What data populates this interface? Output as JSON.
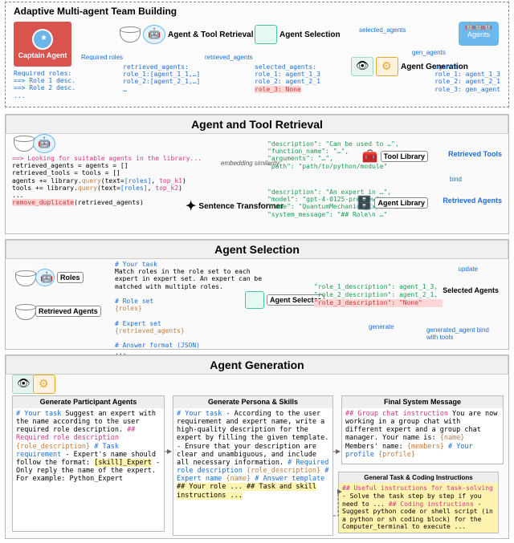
{
  "top": {
    "title": "Adaptive Multi-agent Team Building",
    "captain": "Captain Agent",
    "stages": {
      "retrieval": "Agent & Tool Retrieval",
      "selection": "Agent Selection",
      "generation": "Agent Generation",
      "agents": "Agents"
    },
    "arrows": {
      "required_roles": "Required roles",
      "retrieved_agents": "retrieved_agents",
      "selected_agents": "selected_agents",
      "gen_agents": "gen_agents"
    },
    "required_roles_block": "Required roles:\n==> Role 1 desc.\n==> Role 2 desc.\n...",
    "retrieved_block": "retrieved_agents:\nrole_1:[agent_1_1,…]\nrole_2:[agent_2_1,…]\n…",
    "selected_block": "selected_agents:\nrole_1: agent_1_3\nrole_2: agent_2_1",
    "selected_none": "role_3: None",
    "agents_block": "agents:\nrole_1: agent_1_3\nrole_2: agent_2_1\nrole_3: gen_agent"
  },
  "retrieval": {
    "title": "Agent and Tool Retrieval",
    "code": "==> Looking for suitable agents in the library...\nretrieved_agents = agents = []\nretrieved_tools = tools = []\nagents += library.query(text=[roles], top_k1)\ntools += library.query(text=[roles], top_k2)\n...\nremove_duplicate(retrieved_agents)",
    "sentence_transformer": "Sentence Transformer",
    "embedding_sim": "embedding similarity",
    "tool_json": "\"description\": \"Can be used to …\",\n\"function_name\": \"…\",\n\"arguments\": \"…\",\n\"path\": \"path/to/python/module\"",
    "agent_json": "\"description\": \"An expert in …\",\n\"model\": \"gpt-4-0125-preview\",\n\"name\": \"QuantumMechanics_Expert\",\n\"system_message\": \"## Role\\n …\"",
    "tool_lib": "Tool Library",
    "agent_lib": "Agent Library",
    "retrieved_tools": "Retrieved Tools",
    "retrieved_agents": "Retrieved Agents",
    "bind": "bind"
  },
  "selection": {
    "title": "Agent Selection",
    "roles": "Roles",
    "retrieved_agents": "Retrieved Agents",
    "prompt": "# Your task\nMatch roles in the role set to each\nexpert in expert set. An expert can be\nmatched with multiple roles.\n\n# Role set\n{roles}\n\n# Expert set\n{retrieved_agents}\n\n# Answer format (JSON)\n...",
    "selector": "Agent Selector",
    "selected_json_1": "\"role_1_description\": agent_1_3,",
    "selected_json_2": "\"role_2_description\": agent_2_1,",
    "selected_json_3": "\"role_3_description\": \"None\"",
    "out": "Selected Agents",
    "update": "update",
    "generate": "generate",
    "gen_bind": "generated_agent bind with tools"
  },
  "generation": {
    "title": "Agent Generation",
    "card1_title": "Generate Participant Agents",
    "card1_body": "# Your task\nSuggest an expert with the name\naccording to the user required\nrole description.\n\n## Required role description\n{role_description}\n\n# Task requirement\n- Expert's name should follow the\nformat: [skill]_Expert\n- Only reply the name of the\nexpert. For example: Python_Expert",
    "card2_title": "Generate Persona & Skills",
    "card2_body": "# Your task\n- According to the user requirement and\nexpert name, write a high-quality\ndescription for the expert by filling the\ngiven template.\n- Ensure that your description are clear\nand unambiguous, and include all necessary\ninformation.\n# Required role description\n{role_description}\n# Expert name\n{name}\n# Answer template\n## Your role\n...\n## Task and skill instructions\n...",
    "card3_title": "Final System Message",
    "card3_body": "## Group chat instruction\nYou are now working in a group chat with\ndifferent expert and a group chat manager.\nYour name is: {name}\nMembers' name: {members}\n# Your profile\n{profile}",
    "general_title": "General Task & Coding Instructions",
    "general_body": "## Useful instructions for task-solving\n- Solve the task step by step if you need to\n...\n## Coding instructions\n- Suggest python code or shell script (in a\npython or sh coding block) for the\nComputer_terminal to execute ..."
  }
}
